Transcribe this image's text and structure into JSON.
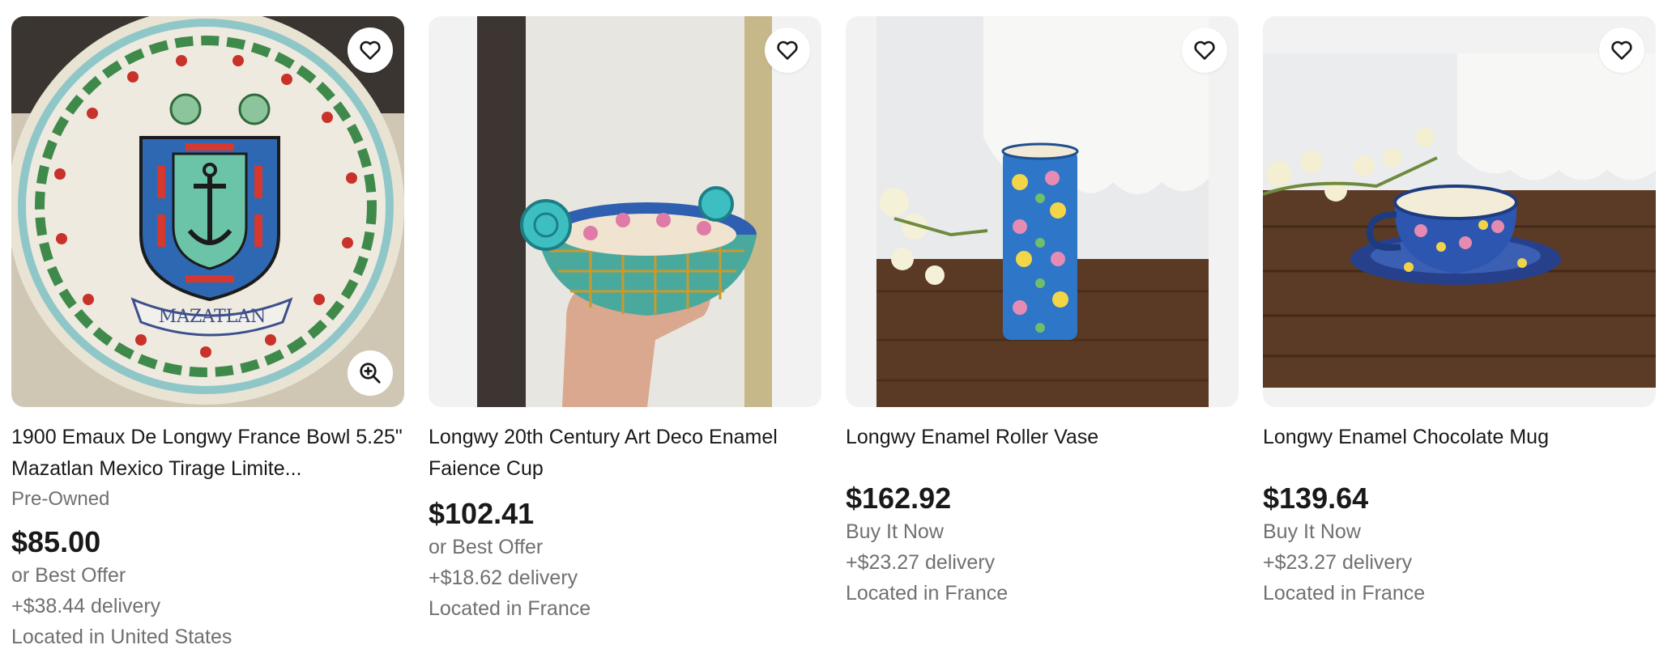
{
  "listings": [
    {
      "title": "1900 Emaux De Longwy France Bowl 5.25\" Mazatlan Mexico Tirage Limite...",
      "condition": "Pre-Owned",
      "price": "$85.00",
      "purchase": "or Best Offer",
      "delivery": "+$38.44 delivery",
      "location": "Located in United States",
      "plate_text": "MAZATLAN",
      "icons": {
        "watch": "heart-icon",
        "zoom": "zoom-in-icon"
      }
    },
    {
      "title": "Longwy 20th Century Art Deco Enamel Faience Cup",
      "price": "$102.41",
      "purchase": "or Best Offer",
      "delivery": "+$18.62 delivery",
      "location": "Located in France",
      "icons": {
        "watch": "heart-icon"
      }
    },
    {
      "title": "Longwy Enamel Roller Vase",
      "price": "$162.92",
      "purchase": "Buy It Now",
      "delivery": "+$23.27 delivery",
      "location": "Located in France",
      "icons": {
        "watch": "heart-icon"
      }
    },
    {
      "title": "Longwy Enamel Chocolate Mug",
      "price": "$139.64",
      "purchase": "Buy It Now",
      "delivery": "+$23.27 delivery",
      "location": "Located in France",
      "icons": {
        "watch": "heart-icon"
      }
    }
  ],
  "colors": {
    "text_primary": "#191919",
    "text_secondary": "#707070",
    "image_bg": "#f2f2f2"
  }
}
